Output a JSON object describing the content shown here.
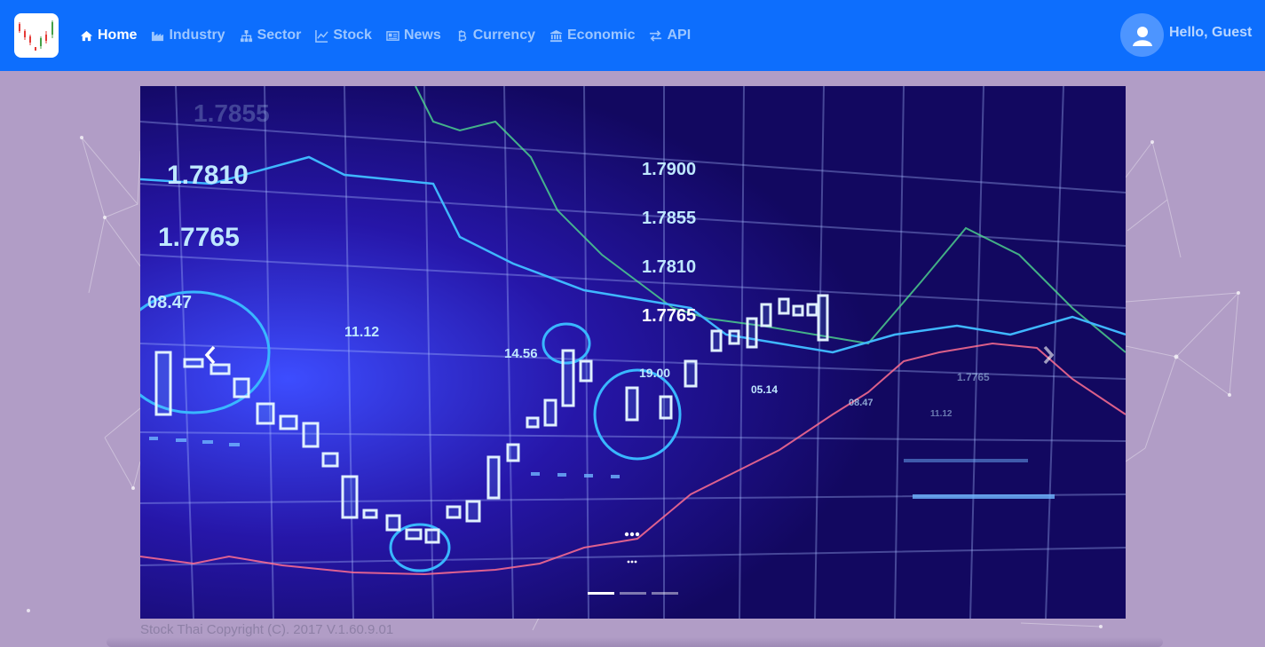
{
  "navbar": {
    "brand_icon": "candlestick-logo-icon",
    "items": [
      {
        "label": "Home",
        "icon": "home-icon",
        "active": true
      },
      {
        "label": "Industry",
        "icon": "industry-icon",
        "active": false
      },
      {
        "label": "Sector",
        "icon": "sitemap-icon",
        "active": false
      },
      {
        "label": "Stock",
        "icon": "line-chart-icon",
        "active": false
      },
      {
        "label": "News",
        "icon": "newspaper-icon",
        "active": false
      },
      {
        "label": "Currency",
        "icon": "bitcoin-icon",
        "active": false
      },
      {
        "label": "Economic",
        "icon": "bank-icon",
        "active": false
      },
      {
        "label": "API",
        "icon": "exchange-icon",
        "active": false
      }
    ],
    "user": {
      "greeting": "Hello, Guest",
      "icon": "user-avatar-icon"
    }
  },
  "carousel": {
    "slide_numbers": [
      "1.7855",
      "1.7810",
      "1.7765",
      "1.7900",
      "1.7855",
      "1.7810",
      "1.7765",
      "08.47",
      "11.12",
      "14.56",
      "19.00",
      "05.14",
      "08.47",
      "11.12",
      "1.7765"
    ],
    "indicators": 3,
    "active_indicator": 0,
    "prev_icon": "chevron-left-icon",
    "next_icon": "chevron-right-icon"
  },
  "footer": {
    "copyright": "Stock Thai Copyright (C). 2017 V.1.60.9.01"
  },
  "colors": {
    "navbar": "#0d6efd",
    "background": "#b19dc6",
    "slide": "#150a5e"
  }
}
